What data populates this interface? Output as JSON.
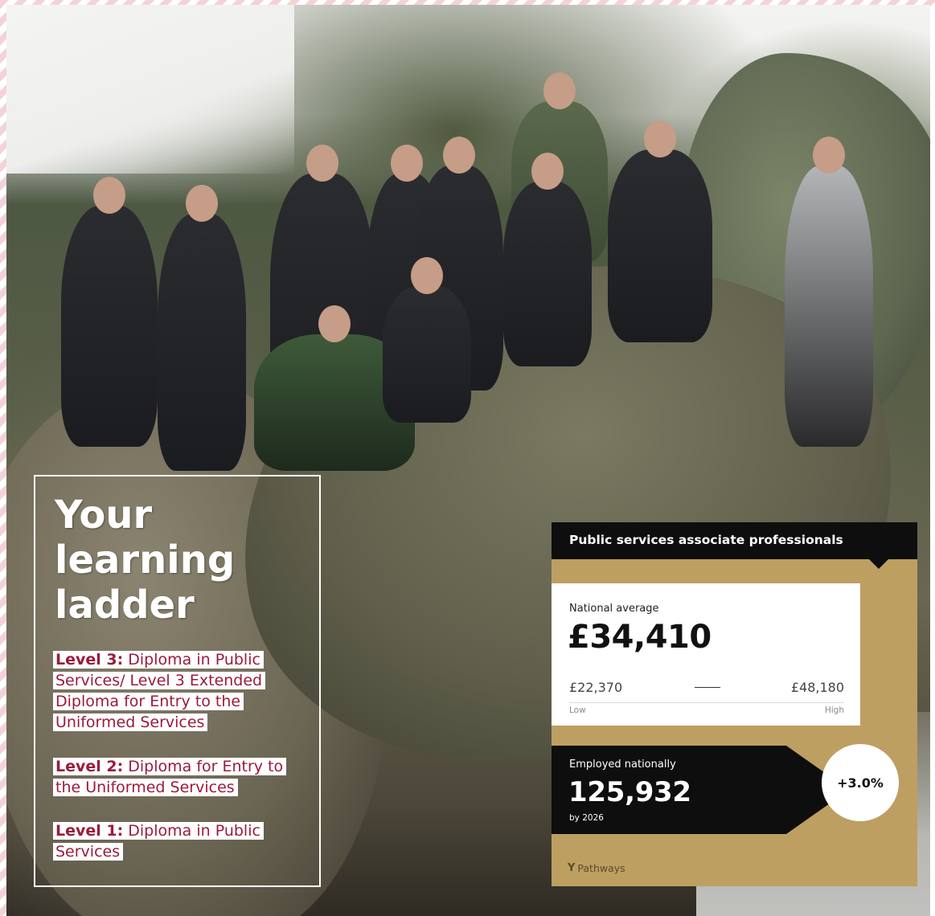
{
  "ladder": {
    "title_line1": "Your",
    "title_line2": "learning",
    "title_line3": "ladder",
    "levels": [
      {
        "label": "Level 3:",
        "text": "Diploma in Public Services/ Level 3 Extended Diploma for Entry to the Uniformed Services"
      },
      {
        "label": "Level 2:",
        "text": "Diploma for Entry to the Uniformed Services"
      },
      {
        "label": "Level 1:",
        "text": "Diploma in Public Services"
      }
    ]
  },
  "card": {
    "title": "Public services associate professionals",
    "salary": {
      "label": "National average",
      "value": "£34,410",
      "low": "£22,370",
      "high": "£48,180",
      "low_label": "Low",
      "high_label": "High"
    },
    "employment": {
      "label": "Employed nationally",
      "value": "125,932",
      "by": "by 2026",
      "growth": "+3.0%"
    },
    "brand": "Pathways",
    "brand_icon": "Y",
    "colors": {
      "gold": "#bd9f62",
      "black": "#0e0e0e",
      "accent_red": "#9b1b3a"
    }
  }
}
